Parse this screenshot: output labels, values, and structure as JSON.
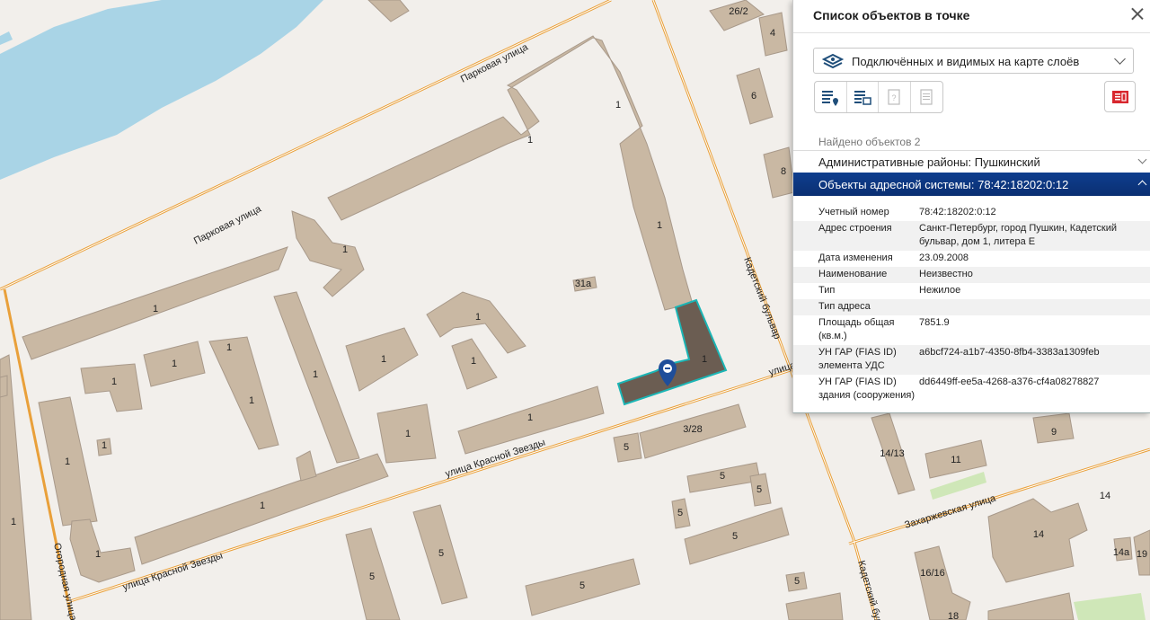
{
  "map": {
    "street_labels": [
      "Парковая улица",
      "Парковая улица",
      "Кадетский бульвар",
      "улица Красной Звезды",
      "улица Красной Звезды",
      "Огородная улица",
      "Захаржевская улица",
      "Кадетский бул",
      "улица"
    ],
    "building_numbers": [
      "26/2",
      "4",
      "6",
      "8",
      "1",
      "1",
      "1",
      "1",
      "1",
      "1",
      "1",
      "1",
      "1",
      "1",
      "1",
      "1",
      "1",
      "1",
      "1",
      "1",
      "1",
      "1",
      "1",
      "1",
      "1",
      "1",
      "1",
      "1",
      "1",
      "31а",
      "3/28",
      "5",
      "5",
      "5",
      "5",
      "5",
      "5",
      "5",
      "5",
      "5",
      "14/13",
      "11",
      "9",
      "14",
      "14",
      "14а",
      "19",
      "16/16",
      "18"
    ],
    "colors": {
      "water": "#a9d4e6",
      "building": "#c9b8a3",
      "building_stroke": "#a8998a",
      "road": "#e9a03a",
      "selected_fill": "#6b5d52",
      "selected_stroke": "#1bb5b5",
      "marker": "#1f4e9a"
    },
    "marker_icon": "map-pin-icon"
  },
  "panel": {
    "title": "Список объектов в точке",
    "layer_select": {
      "icon": "layers-icon",
      "value": "Подключённых и видимых на карте слоёв"
    },
    "toolbar": {
      "buttons": [
        {
          "name": "list-pin-button",
          "icon": "list-pin-icon"
        },
        {
          "name": "list-select-button",
          "icon": "list-select-icon"
        },
        {
          "name": "unknown-object-button",
          "icon": "question-doc-icon"
        },
        {
          "name": "document-button",
          "icon": "document-icon"
        }
      ],
      "report_icon": "report-icon"
    },
    "found_text": "Найдено объектов 2",
    "groups": [
      {
        "label": "Административные районы: Пушкинский",
        "expanded": false
      },
      {
        "label": "Объекты адресной системы: 78:42:18202:0:12",
        "expanded": true
      }
    ],
    "attributes": [
      {
        "name": "Учетный номер",
        "value": "78:42:18202:0:12"
      },
      {
        "name": "Адрес строения",
        "value": "Санкт-Петербург, город Пушкин, Кадетский бульвар, дом 1, литера Е"
      },
      {
        "name": "Дата изменения",
        "value": "23.09.2008"
      },
      {
        "name": "Наименование",
        "value": "Неизвестно"
      },
      {
        "name": "Тип",
        "value": "Нежилое"
      },
      {
        "name": "Тип адреса",
        "value": ""
      },
      {
        "name": "Площадь общая (кв.м.)",
        "value": "7851.9"
      },
      {
        "name": "УН ГАР (FIAS ID) элемента УДС",
        "value": "a6bcf724-a1b7-4350-8fb4-3383a1309feb"
      },
      {
        "name": "УН ГАР (FIAS ID) здания (сооружения)",
        "value": "dd6449ff-ee5a-4268-a376-cf4a08278827"
      }
    ]
  }
}
